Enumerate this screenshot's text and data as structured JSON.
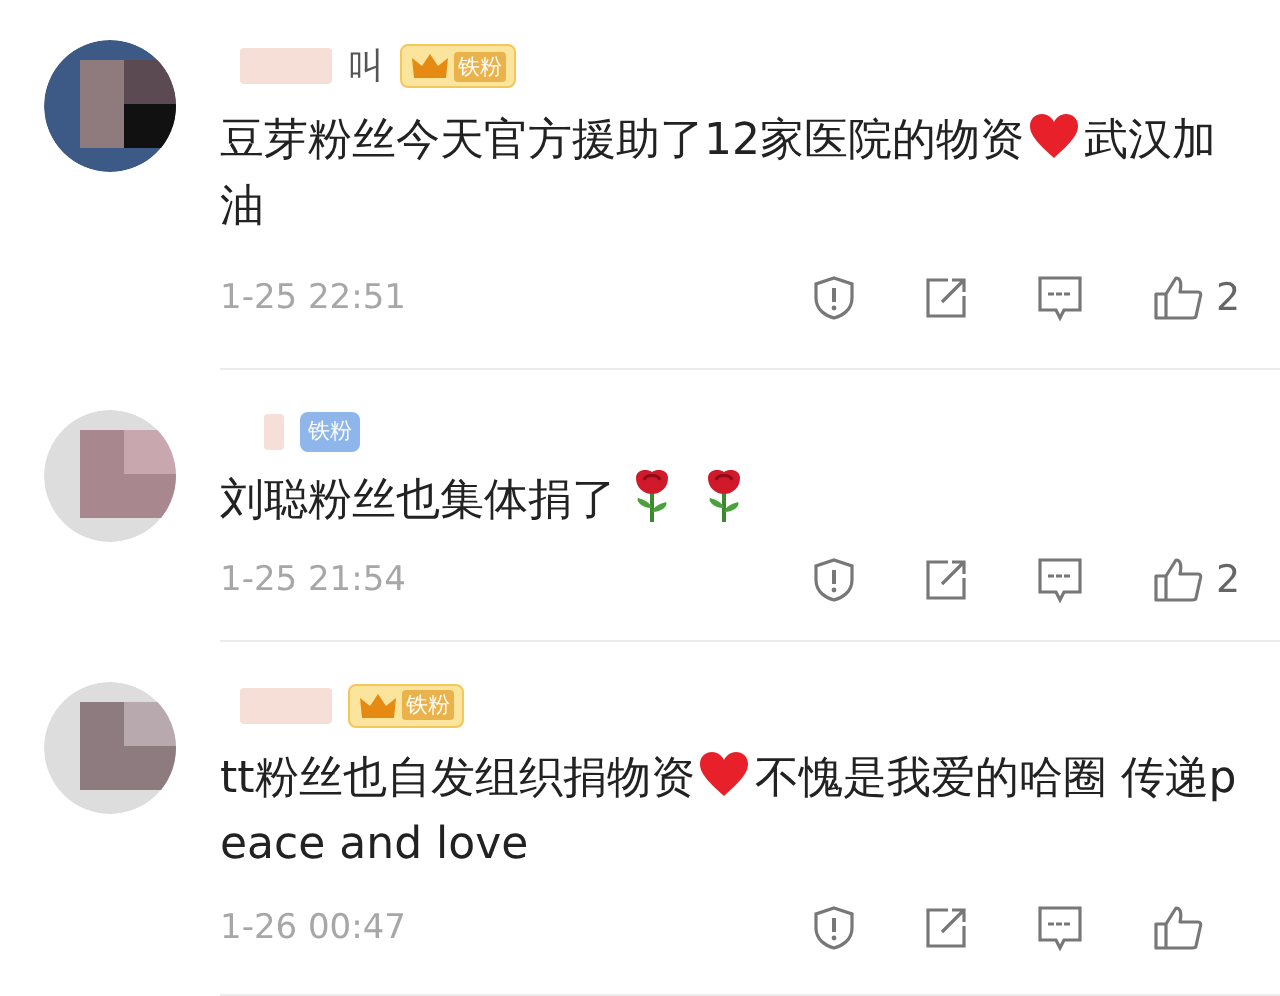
{
  "comments": [
    {
      "name_fragment": "叫",
      "badge": {
        "kind": "crown",
        "label": "铁粉"
      },
      "content": [
        {
          "kind": "text",
          "text": "豆芽粉丝今天官方援助了12家医院的物资"
        },
        {
          "kind": "heart"
        },
        {
          "kind": "text",
          "text": "武汉加油"
        }
      ],
      "time": "1-25 22:51",
      "likes": "2"
    },
    {
      "badge": {
        "kind": "plain",
        "label": "铁粉"
      },
      "content": [
        {
          "kind": "text",
          "text": "刘聪粉丝也集体捐了"
        },
        {
          "kind": "rose"
        },
        {
          "kind": "rose"
        }
      ],
      "time": "1-25 21:54",
      "likes": "2"
    },
    {
      "badge": {
        "kind": "crown",
        "label": "铁粉"
      },
      "content": [
        {
          "kind": "text",
          "text": "tt粉丝也自发组织捐物资"
        },
        {
          "kind": "heart"
        },
        {
          "kind": "text",
          "text": "不愧是我爱的哈圈 传递peace and love"
        }
      ],
      "time": "1-26 00:47"
    }
  ]
}
